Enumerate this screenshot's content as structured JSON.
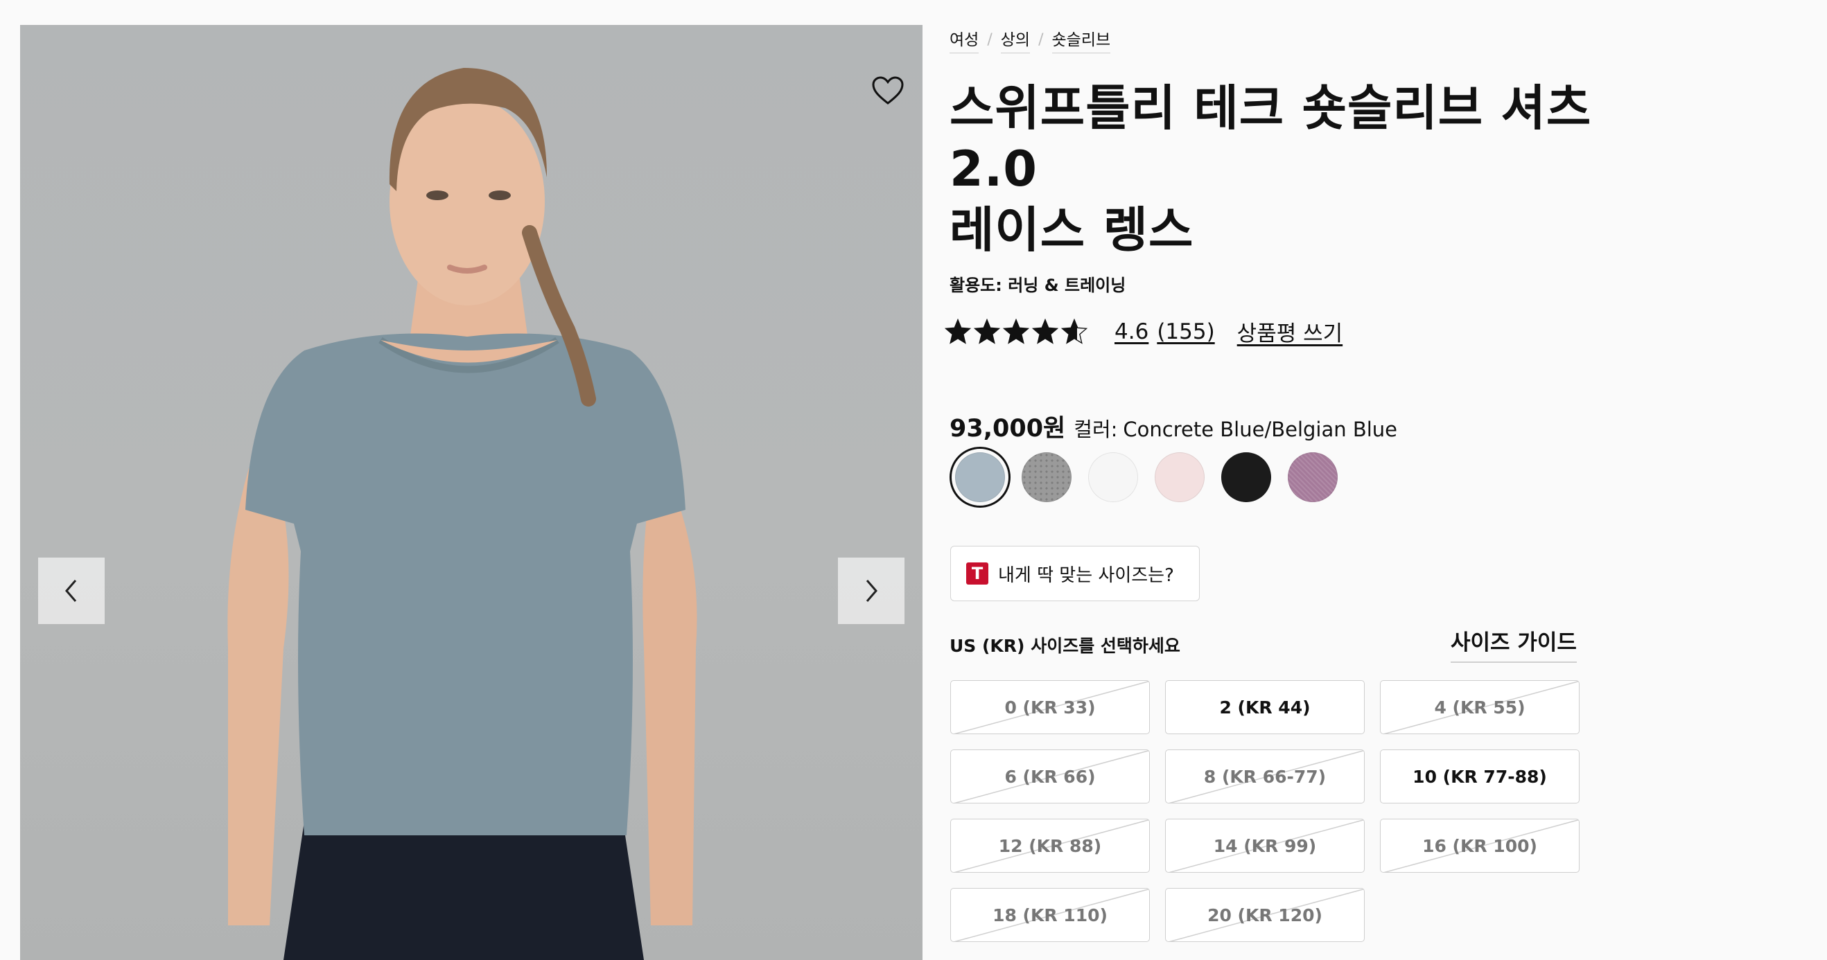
{
  "gallery": {
    "image_alt": "product photo",
    "wishlist_icon": "heart-outline-icon",
    "prev_icon": "chevron-left-icon",
    "next_icon": "chevron-right-icon"
  },
  "breadcrumb": [
    "여성",
    "상의",
    "숏슬리브"
  ],
  "product": {
    "title_lines": [
      "스위프틀리 테크 숏슬리브 셔츠",
      "2.0",
      "레이스 렝스"
    ],
    "activity": "활용도: 러닝 & 트레이닝",
    "rating": 4.6,
    "rating_text": "4.6",
    "review_count": "(155)",
    "write_review": "상품평 쓰기",
    "price": "93,000원",
    "color_label": "컬러:",
    "color_name": "Concrete Blue/Belgian Blue"
  },
  "swatches": [
    {
      "name": "Concrete Blue/Belgian Blue",
      "color": "#a9b8c3",
      "selected": true
    },
    {
      "name": "Heathered grey",
      "color": "#9a9a9a",
      "selected": false
    },
    {
      "name": "White",
      "color": "#f6f6f6",
      "selected": false
    },
    {
      "name": "Pink",
      "color": "#f3e0e0",
      "selected": false
    },
    {
      "name": "Black",
      "color": "#1b1b1b",
      "selected": false
    },
    {
      "name": "Purple heather",
      "color": "#a57a9a",
      "selected": false
    }
  ],
  "fit": {
    "icon": "T",
    "icon_color": "#c8102e",
    "label": "내게 딱 맞는 사이즈는?"
  },
  "sizes": {
    "heading": "US (KR) 사이즈를 선택하세요",
    "guide_label": "사이즈 가이드",
    "options": [
      {
        "label": "0 (KR 33)",
        "available": false
      },
      {
        "label": "2 (KR 44)",
        "available": true
      },
      {
        "label": "4 (KR 55)",
        "available": false
      },
      {
        "label": "6 (KR 66)",
        "available": false
      },
      {
        "label": "8 (KR 66-77)",
        "available": false
      },
      {
        "label": "10 (KR 77-88)",
        "available": true
      },
      {
        "label": "12 (KR 88)",
        "available": false
      },
      {
        "label": "14 (KR 99)",
        "available": false
      },
      {
        "label": "16 (KR 100)",
        "available": false
      },
      {
        "label": "18 (KR 110)",
        "available": false
      },
      {
        "label": "20 (KR 120)",
        "available": false
      }
    ]
  }
}
